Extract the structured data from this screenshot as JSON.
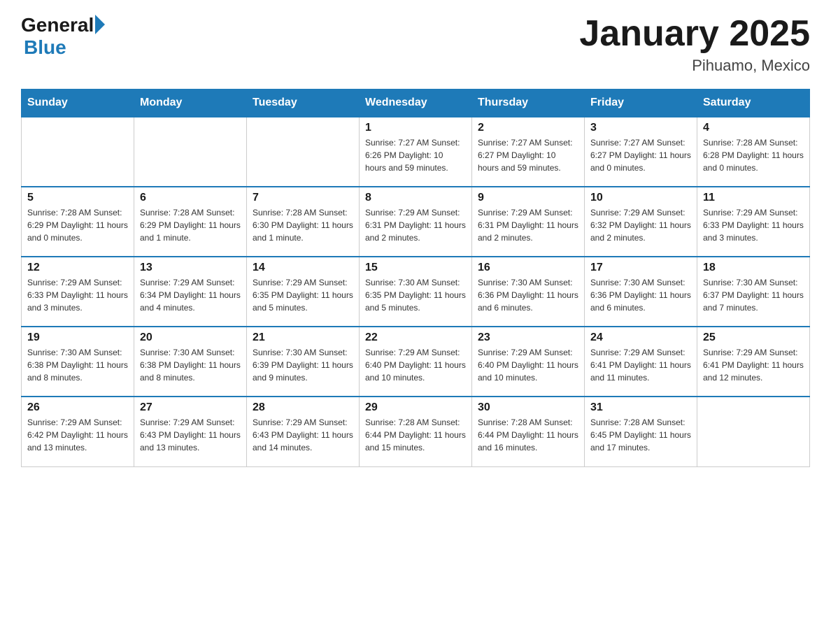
{
  "header": {
    "logo_general": "General",
    "logo_blue": "Blue",
    "title": "January 2025",
    "subtitle": "Pihuamo, Mexico"
  },
  "weekdays": [
    "Sunday",
    "Monday",
    "Tuesday",
    "Wednesday",
    "Thursday",
    "Friday",
    "Saturday"
  ],
  "weeks": [
    [
      {
        "day": "",
        "info": ""
      },
      {
        "day": "",
        "info": ""
      },
      {
        "day": "",
        "info": ""
      },
      {
        "day": "1",
        "info": "Sunrise: 7:27 AM\nSunset: 6:26 PM\nDaylight: 10 hours\nand 59 minutes."
      },
      {
        "day": "2",
        "info": "Sunrise: 7:27 AM\nSunset: 6:27 PM\nDaylight: 10 hours\nand 59 minutes."
      },
      {
        "day": "3",
        "info": "Sunrise: 7:27 AM\nSunset: 6:27 PM\nDaylight: 11 hours\nand 0 minutes."
      },
      {
        "day": "4",
        "info": "Sunrise: 7:28 AM\nSunset: 6:28 PM\nDaylight: 11 hours\nand 0 minutes."
      }
    ],
    [
      {
        "day": "5",
        "info": "Sunrise: 7:28 AM\nSunset: 6:29 PM\nDaylight: 11 hours\nand 0 minutes."
      },
      {
        "day": "6",
        "info": "Sunrise: 7:28 AM\nSunset: 6:29 PM\nDaylight: 11 hours\nand 1 minute."
      },
      {
        "day": "7",
        "info": "Sunrise: 7:28 AM\nSunset: 6:30 PM\nDaylight: 11 hours\nand 1 minute."
      },
      {
        "day": "8",
        "info": "Sunrise: 7:29 AM\nSunset: 6:31 PM\nDaylight: 11 hours\nand 2 minutes."
      },
      {
        "day": "9",
        "info": "Sunrise: 7:29 AM\nSunset: 6:31 PM\nDaylight: 11 hours\nand 2 minutes."
      },
      {
        "day": "10",
        "info": "Sunrise: 7:29 AM\nSunset: 6:32 PM\nDaylight: 11 hours\nand 2 minutes."
      },
      {
        "day": "11",
        "info": "Sunrise: 7:29 AM\nSunset: 6:33 PM\nDaylight: 11 hours\nand 3 minutes."
      }
    ],
    [
      {
        "day": "12",
        "info": "Sunrise: 7:29 AM\nSunset: 6:33 PM\nDaylight: 11 hours\nand 3 minutes."
      },
      {
        "day": "13",
        "info": "Sunrise: 7:29 AM\nSunset: 6:34 PM\nDaylight: 11 hours\nand 4 minutes."
      },
      {
        "day": "14",
        "info": "Sunrise: 7:29 AM\nSunset: 6:35 PM\nDaylight: 11 hours\nand 5 minutes."
      },
      {
        "day": "15",
        "info": "Sunrise: 7:30 AM\nSunset: 6:35 PM\nDaylight: 11 hours\nand 5 minutes."
      },
      {
        "day": "16",
        "info": "Sunrise: 7:30 AM\nSunset: 6:36 PM\nDaylight: 11 hours\nand 6 minutes."
      },
      {
        "day": "17",
        "info": "Sunrise: 7:30 AM\nSunset: 6:36 PM\nDaylight: 11 hours\nand 6 minutes."
      },
      {
        "day": "18",
        "info": "Sunrise: 7:30 AM\nSunset: 6:37 PM\nDaylight: 11 hours\nand 7 minutes."
      }
    ],
    [
      {
        "day": "19",
        "info": "Sunrise: 7:30 AM\nSunset: 6:38 PM\nDaylight: 11 hours\nand 8 minutes."
      },
      {
        "day": "20",
        "info": "Sunrise: 7:30 AM\nSunset: 6:38 PM\nDaylight: 11 hours\nand 8 minutes."
      },
      {
        "day": "21",
        "info": "Sunrise: 7:30 AM\nSunset: 6:39 PM\nDaylight: 11 hours\nand 9 minutes."
      },
      {
        "day": "22",
        "info": "Sunrise: 7:29 AM\nSunset: 6:40 PM\nDaylight: 11 hours\nand 10 minutes."
      },
      {
        "day": "23",
        "info": "Sunrise: 7:29 AM\nSunset: 6:40 PM\nDaylight: 11 hours\nand 10 minutes."
      },
      {
        "day": "24",
        "info": "Sunrise: 7:29 AM\nSunset: 6:41 PM\nDaylight: 11 hours\nand 11 minutes."
      },
      {
        "day": "25",
        "info": "Sunrise: 7:29 AM\nSunset: 6:41 PM\nDaylight: 11 hours\nand 12 minutes."
      }
    ],
    [
      {
        "day": "26",
        "info": "Sunrise: 7:29 AM\nSunset: 6:42 PM\nDaylight: 11 hours\nand 13 minutes."
      },
      {
        "day": "27",
        "info": "Sunrise: 7:29 AM\nSunset: 6:43 PM\nDaylight: 11 hours\nand 13 minutes."
      },
      {
        "day": "28",
        "info": "Sunrise: 7:29 AM\nSunset: 6:43 PM\nDaylight: 11 hours\nand 14 minutes."
      },
      {
        "day": "29",
        "info": "Sunrise: 7:28 AM\nSunset: 6:44 PM\nDaylight: 11 hours\nand 15 minutes."
      },
      {
        "day": "30",
        "info": "Sunrise: 7:28 AM\nSunset: 6:44 PM\nDaylight: 11 hours\nand 16 minutes."
      },
      {
        "day": "31",
        "info": "Sunrise: 7:28 AM\nSunset: 6:45 PM\nDaylight: 11 hours\nand 17 minutes."
      },
      {
        "day": "",
        "info": ""
      }
    ]
  ]
}
